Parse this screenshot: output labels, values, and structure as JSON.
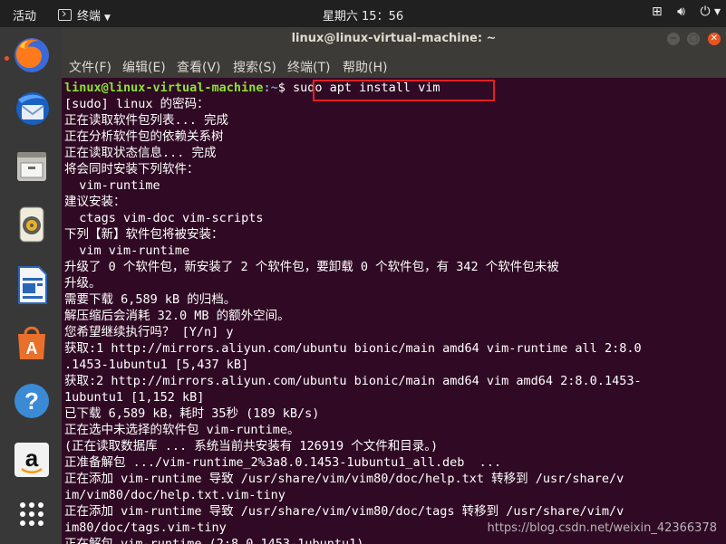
{
  "topbar": {
    "activities": "活动",
    "app_name": "终端",
    "clock": "星期六 15：56",
    "tray": {
      "network": "network-icon",
      "volume": "volume-icon",
      "power": "power-icon"
    }
  },
  "window": {
    "title": "linux@linux-virtual-machine: ~",
    "menu": [
      "文件(F)",
      "编辑(E)",
      "查看(V)",
      "搜索(S)",
      "终端(T)",
      "帮助(H)"
    ]
  },
  "dock": [
    {
      "name": "firefox-icon",
      "label": "Firefox"
    },
    {
      "name": "thunderbird-icon",
      "label": "Thunderbird"
    },
    {
      "name": "files-icon",
      "label": "Files"
    },
    {
      "name": "rhythmbox-icon",
      "label": "Rhythmbox"
    },
    {
      "name": "writer-icon",
      "label": "LibreOffice Writer"
    },
    {
      "name": "software-icon",
      "label": "Ubuntu Software"
    },
    {
      "name": "help-icon",
      "label": "Help"
    },
    {
      "name": "amazon-icon",
      "label": "Amazon"
    },
    {
      "name": "app-grid-icon",
      "label": "Show Applications"
    }
  ],
  "terminal": {
    "prompt_user": "linux@linux-virtual-machine",
    "prompt_path": ":~",
    "prompt_symbol": "$ ",
    "command": "sudo apt install vim",
    "lines": [
      "[sudo] linux 的密码：",
      "正在读取软件包列表... 完成",
      "正在分析软件包的依赖关系树",
      "正在读取状态信息... 完成",
      "将会同时安装下列软件：",
      "  vim-runtime",
      "建议安装：",
      "  ctags vim-doc vim-scripts",
      "下列【新】软件包将被安装：",
      "  vim vim-runtime",
      "升级了 0 个软件包，新安装了 2 个软件包，要卸载 0 个软件包，有 342 个软件包未被",
      "升级。",
      "需要下载 6,589 kB 的归档。",
      "解压缩后会消耗 32.0 MB 的额外空间。",
      "您希望继续执行吗？ [Y/n] y",
      "获取:1 http://mirrors.aliyun.com/ubuntu bionic/main amd64 vim-runtime all 2:8.0",
      ".1453-1ubuntu1 [5,437 kB]",
      "获取:2 http://mirrors.aliyun.com/ubuntu bionic/main amd64 vim amd64 2:8.0.1453-",
      "1ubuntu1 [1,152 kB]",
      "已下载 6,589 kB，耗时 35秒 (189 kB/s)",
      "正在选中未选择的软件包 vim-runtime。",
      "(正在读取数据库 ... 系统当前共安装有 126919 个文件和目录。)",
      "正准备解包 .../vim-runtime_2%3a8.0.1453-1ubuntu1_all.deb  ...",
      "正在添加 vim-runtime 导致 /usr/share/vim/vim80/doc/help.txt 转移到 /usr/share/v",
      "im/vim80/doc/help.txt.vim-tiny",
      "正在添加 vim-runtime 导致 /usr/share/vim/vim80/doc/tags 转移到 /usr/share/vim/v",
      "im80/doc/tags.vim-tiny",
      "正在解包 vim-runtime (2:8.0.1453-1ubuntu1) ..."
    ]
  },
  "watermark": "https://blog.csdn.net/weixin_42366378",
  "colors": {
    "terminal_bg": "#300a24",
    "prompt_user": "#8ae234",
    "prompt_path": "#729fcf",
    "highlight_box": "#e32020",
    "accent": "#e95420"
  }
}
